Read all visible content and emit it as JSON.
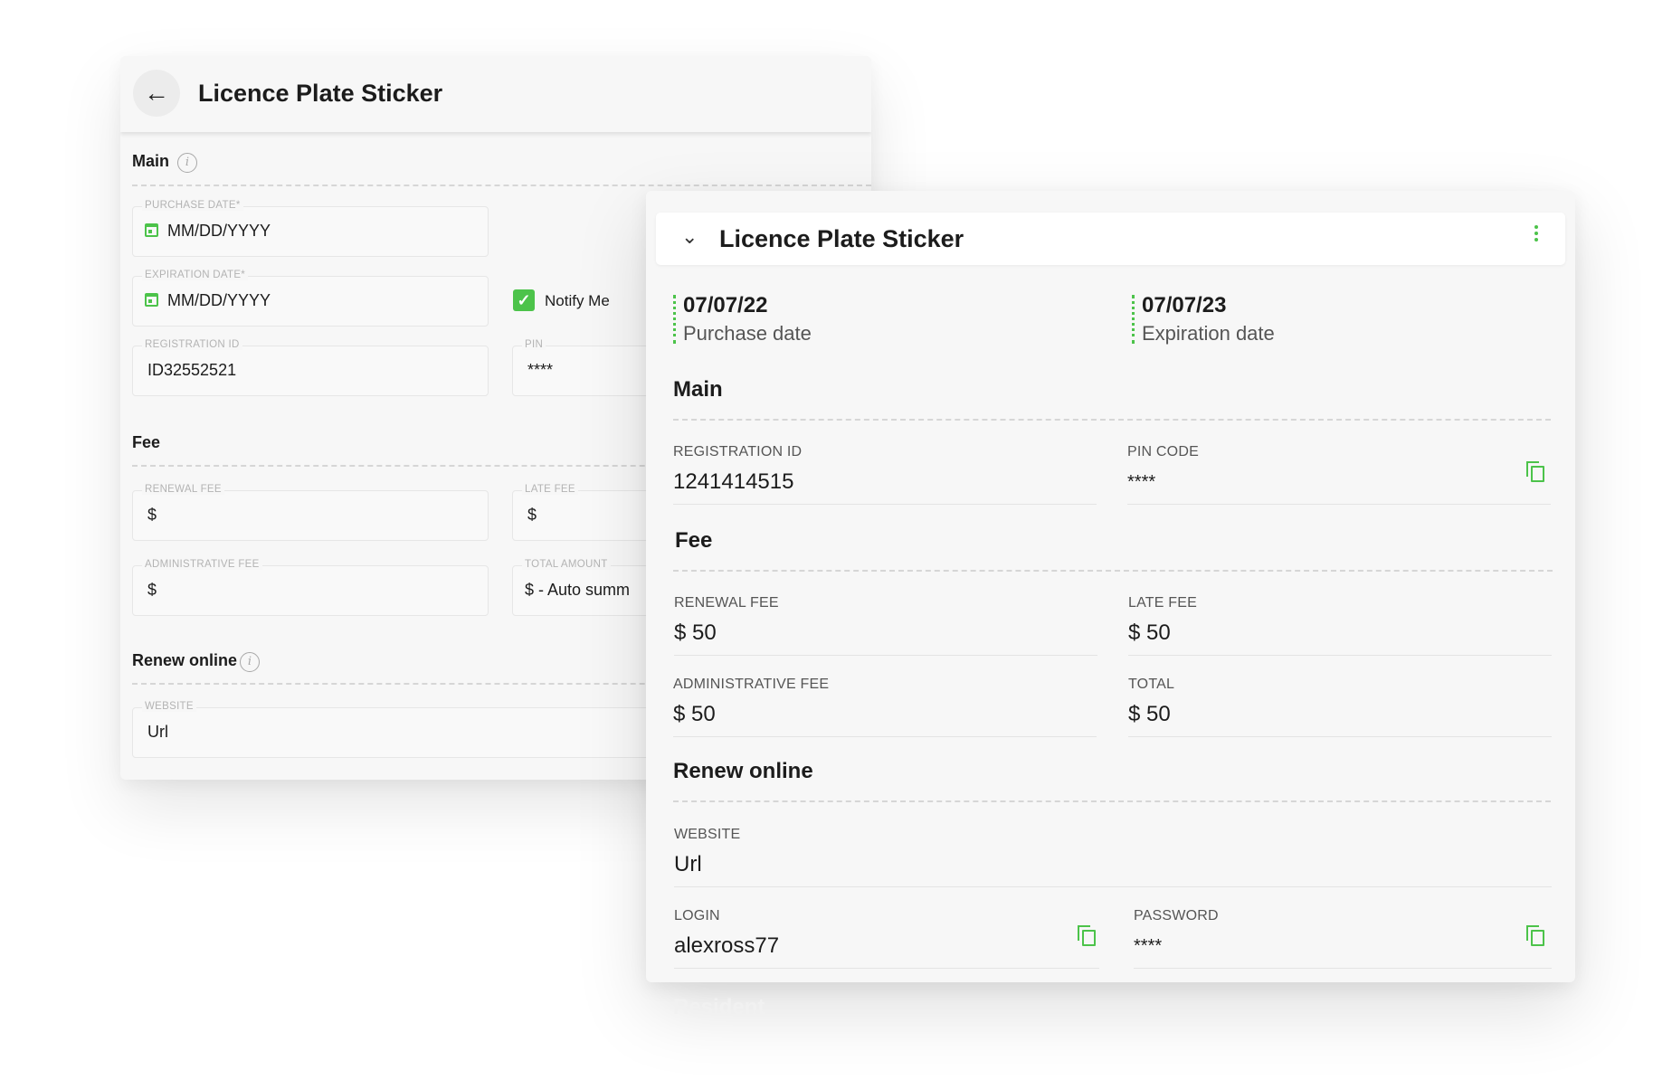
{
  "edit_form": {
    "title": "Licence Plate Sticker",
    "back_icon": "arrow-left-icon",
    "main_section": "Main",
    "fee_section": "Fee",
    "renew_section": "Renew online",
    "purchase_date": {
      "label": "PURCHASE DATE*",
      "placeholder": "MM/DD/YYYY"
    },
    "expiration_date": {
      "label": "EXPIRATION DATE*",
      "placeholder": "MM/DD/YYYY"
    },
    "notify_me": {
      "label": "Notify Me",
      "checked": true
    },
    "registration_id": {
      "label": "REGISTRATION ID",
      "value": "ID32552521"
    },
    "pin": {
      "label": "PIN",
      "value": "****"
    },
    "renewal_fee": {
      "label": "RENEWAL FEE",
      "value": "$"
    },
    "late_fee": {
      "label": "LATE FEE",
      "value": "$"
    },
    "administrative_fee": {
      "label": "ADMINISTRATIVE FEE",
      "value": "$"
    },
    "total_amount": {
      "label": "TOTAL AMOUNT",
      "value": "$ - Auto summ"
    },
    "website": {
      "label": "WEBSITE",
      "value": "Url"
    }
  },
  "view_card": {
    "title": "Licence Plate Sticker",
    "purchase": {
      "date": "07/07/22",
      "caption": "Purchase date"
    },
    "expiration": {
      "date": "07/07/23",
      "caption": "Expiration date"
    },
    "main_section": "Main",
    "fee_section": "Fee",
    "renew_section": "Renew online",
    "registration_id": {
      "label": "REGISTRATION ID",
      "value": "1241414515"
    },
    "pin_code": {
      "label": "PIN CODE",
      "value": "****"
    },
    "renewal_fee": {
      "label": "RENEWAL FEE",
      "value": "$ 50"
    },
    "late_fee": {
      "label": "LATE FEE",
      "value": "$ 50"
    },
    "administrative_fee": {
      "label": "ADMINISTRATIVE FEE",
      "value": "$ 50"
    },
    "total": {
      "label": "TOTAL",
      "value": "$ 50"
    },
    "website": {
      "label": "WEBSITE",
      "value": "Url"
    },
    "login": {
      "label": "LOGIN",
      "value": "alexross77"
    },
    "password": {
      "label": "PASSWORD",
      "value": "****"
    },
    "next_section_faded": "Resident"
  },
  "colors": {
    "accent": "#4cc34a",
    "card_bg": "#f7f7f7",
    "text": "#1c1c1c"
  }
}
